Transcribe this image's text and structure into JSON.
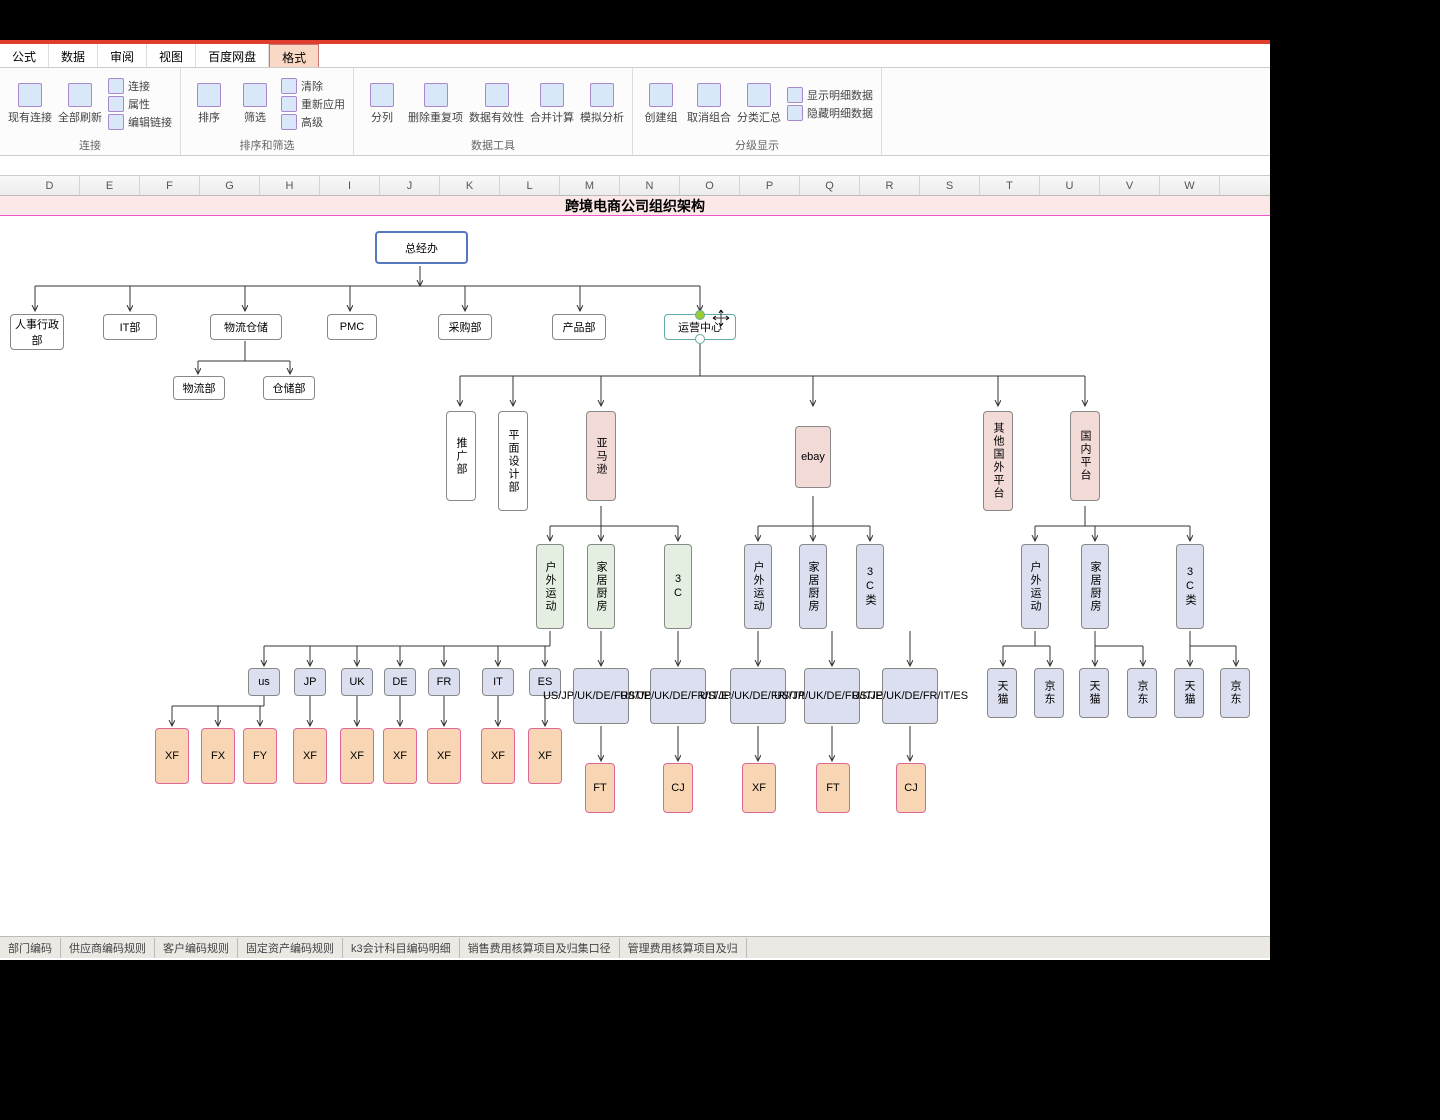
{
  "tabs": [
    "公式",
    "数据",
    "审阅",
    "视图",
    "百度网盘",
    "格式"
  ],
  "active_tab": 5,
  "ribbon": [
    {
      "label": "连接",
      "items": [
        "现有连接",
        "全部刷新"
      ],
      "sub": [
        "连接",
        "属性",
        "编辑链接"
      ]
    },
    {
      "label": "排序和筛选",
      "items": [
        "排序",
        "筛选"
      ],
      "sub": [
        "清除",
        "重新应用",
        "高级"
      ]
    },
    {
      "label": "数据工具",
      "items": [
        "分列",
        "删除重复项",
        "数据有效性",
        "合并计算",
        "模拟分析"
      ]
    },
    {
      "label": "分级显示",
      "items": [
        "创建组",
        "取消组合",
        "分类汇总"
      ],
      "sub": [
        "显示明细数据",
        "隐藏明细数据"
      ]
    }
  ],
  "columns": [
    "D",
    "E",
    "F",
    "G",
    "H",
    "I",
    "J",
    "K",
    "L",
    "M",
    "N",
    "O",
    "P",
    "Q",
    "R",
    "S",
    "T",
    "U",
    "V",
    "W"
  ],
  "title": "跨境电商公司组织架构",
  "nodes": {
    "gm": "总经办",
    "row2": [
      "人事行政部",
      "IT部",
      "物流仓储",
      "PMC",
      "采购部",
      "产品部",
      "运营中心"
    ],
    "wl": [
      "物流部",
      "仓储部"
    ],
    "op": [
      "推广部",
      "平面设计部",
      "亚马逊",
      "ebay",
      "其他国外平台",
      "国内平台"
    ],
    "cat": [
      "户外运动",
      "家居厨房",
      "3C"
    ],
    "cat2": [
      "户外运动",
      "家居厨房",
      "3C类"
    ],
    "cat3": [
      "户外运动",
      "家居厨房",
      "3C类"
    ],
    "us_row": [
      "us",
      "JP",
      "UK",
      "DE",
      "FR",
      "IT",
      "ES"
    ],
    "xf_row": [
      "XF",
      "FX",
      "FY",
      "XF",
      "XF",
      "XF",
      "XF",
      "XF",
      "XF"
    ],
    "region": "US/JP/UK/DE/FR/IT/ES",
    "leaf": [
      "FT",
      "CJ",
      "XF",
      "FT",
      "CJ"
    ],
    "cn": [
      "天猫",
      "京东",
      "天猫",
      "京东",
      "天猫",
      "京东"
    ]
  },
  "sheets": [
    "部门编码",
    "供应商编码规则",
    "客户编码规则",
    "固定资产编码规则",
    "k3会计科目编码明细",
    "销售费用核算项目及归集口径",
    "管理费用核算项目及归"
  ]
}
